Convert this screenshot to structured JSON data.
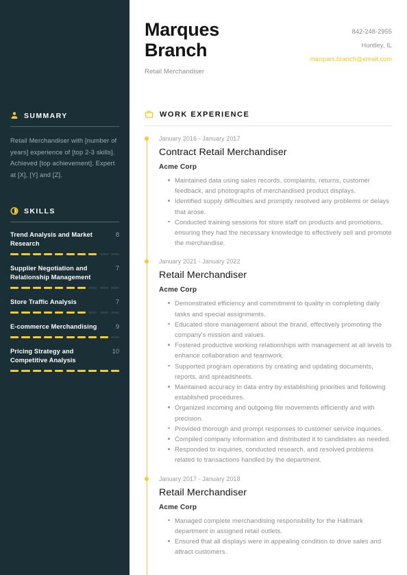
{
  "theme": {
    "sidebar_bg": "#1b2f37",
    "accent": "#f5cb2e",
    "text_dark": "#141414",
    "text_muted": "#8c8c8c"
  },
  "header": {
    "first_name": "Marques",
    "last_name": "Branch",
    "job_title": "Retail Merchandiser",
    "phone": "842-248-2955",
    "location": "Huntley, IL",
    "email": "marques.branch@email.com"
  },
  "sidebar": {
    "summary": {
      "icon": "person-icon",
      "title": "SUMMARY",
      "text": "Retail Merchandiser with [number of years] experience of [top 2-3 skills]. Achieved [top achievement]. Expert at [X], [Y] and [Z]."
    },
    "skills": {
      "icon": "skill-gauge-icon",
      "title": "SKILLS",
      "max": 10,
      "items": [
        {
          "name": "Trend Analysis and Market Research",
          "score": 8
        },
        {
          "name": "Supplier Negotiation and Relationship Management",
          "score": 7
        },
        {
          "name": "Store Traffic Analysis",
          "score": 7
        },
        {
          "name": "E-commerce Merchandising",
          "score": 9
        },
        {
          "name": "Pricing Strategy and Competitive Analysis",
          "score": 10
        }
      ]
    }
  },
  "experience": {
    "icon": "briefcase-icon",
    "title": "WORK EXPERIENCE",
    "jobs": [
      {
        "date": "January 2016 - January 2017",
        "role": "Contract Retail Merchandiser",
        "company": "Acme Corp",
        "bullets": [
          "Maintained data using sales records, complaints, returns, customer feedback, and photographs of merchandised product displays.",
          "Identified supply difficulties and promptly resolved any problems or delays that arose.",
          "Conducted training sessions for store staff on products and promotions, ensuring they had the necessary knowledge to effectively sell and promote the merchandise."
        ]
      },
      {
        "date": "January 2021 - January 2022",
        "role": "Retail Merchandiser",
        "company": "Acme Corp",
        "bullets": [
          "Demonstrated efficiency and commitment to quality in completing daily tasks and special assignments.",
          "Educated store management about the brand, effectively promoting the company's mission and values.",
          "Fostered productive working relationships with management at all levels to enhance collaboration and teamwork.",
          "Supported program operations by creating and updating documents, reports, and spreadsheets.",
          "Maintained accuracy in data entry by establishing priorities and following established procedures.",
          "Organized incoming and outgoing file movements efficiently and with precision.",
          "Provided thorough and prompt responses to customer service inquiries.",
          "Compiled company information and distributed it to candidates as needed.",
          "Responded to inquiries, conducted research, and resolved problems related to transactions handled by the department."
        ]
      },
      {
        "date": "January 2017 - January 2018",
        "role": "Retail Merchandiser",
        "company": "Acme Corp",
        "bullets": [
          "Managed complete merchandising responsibility for the Hallmark department in assigned retail outlets.",
          "Ensured that all displays were in appealing condition to drive sales and attract customers."
        ]
      }
    ]
  }
}
